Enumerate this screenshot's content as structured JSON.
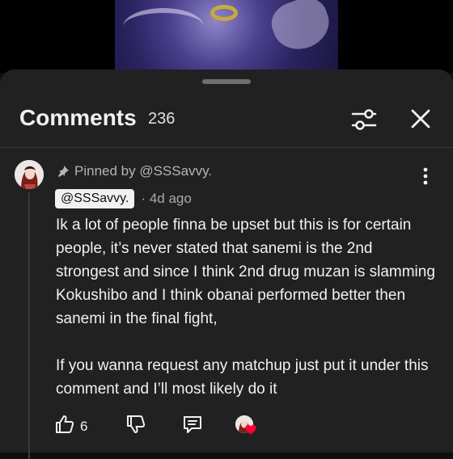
{
  "comments_header": {
    "title": "Comments",
    "count": "236"
  },
  "comment": {
    "pinned_label": "Pinned by @SSSavvy.",
    "author": "@SSSavvy.",
    "time": "4d ago",
    "paragraphs": [
      "Ik a lot of people finna be upset but this is for certain people, it’s never stated that sanemi is the 2nd strongest and since I think 2nd drug muzan is slamming Kokushibo and I think obanai performed better then sanemi in the final fight,",
      "If you wanna request any matchup just put it under this comment and I’ll most likely do it"
    ],
    "like_count": "6"
  },
  "icons": {
    "filter": "filter-sliders-icon",
    "close": "close-icon",
    "pin": "pin-icon",
    "more": "more-vertical-icon",
    "like": "thumbs-up-icon",
    "dislike": "thumbs-down-icon",
    "reply": "reply-comment-icon",
    "creator_heart": "creator-heart-icon"
  },
  "colors": {
    "sheet_bg": "#212121",
    "text": "#f1f1f1",
    "muted": "#aaaaaa",
    "heart": "#ff0033"
  }
}
